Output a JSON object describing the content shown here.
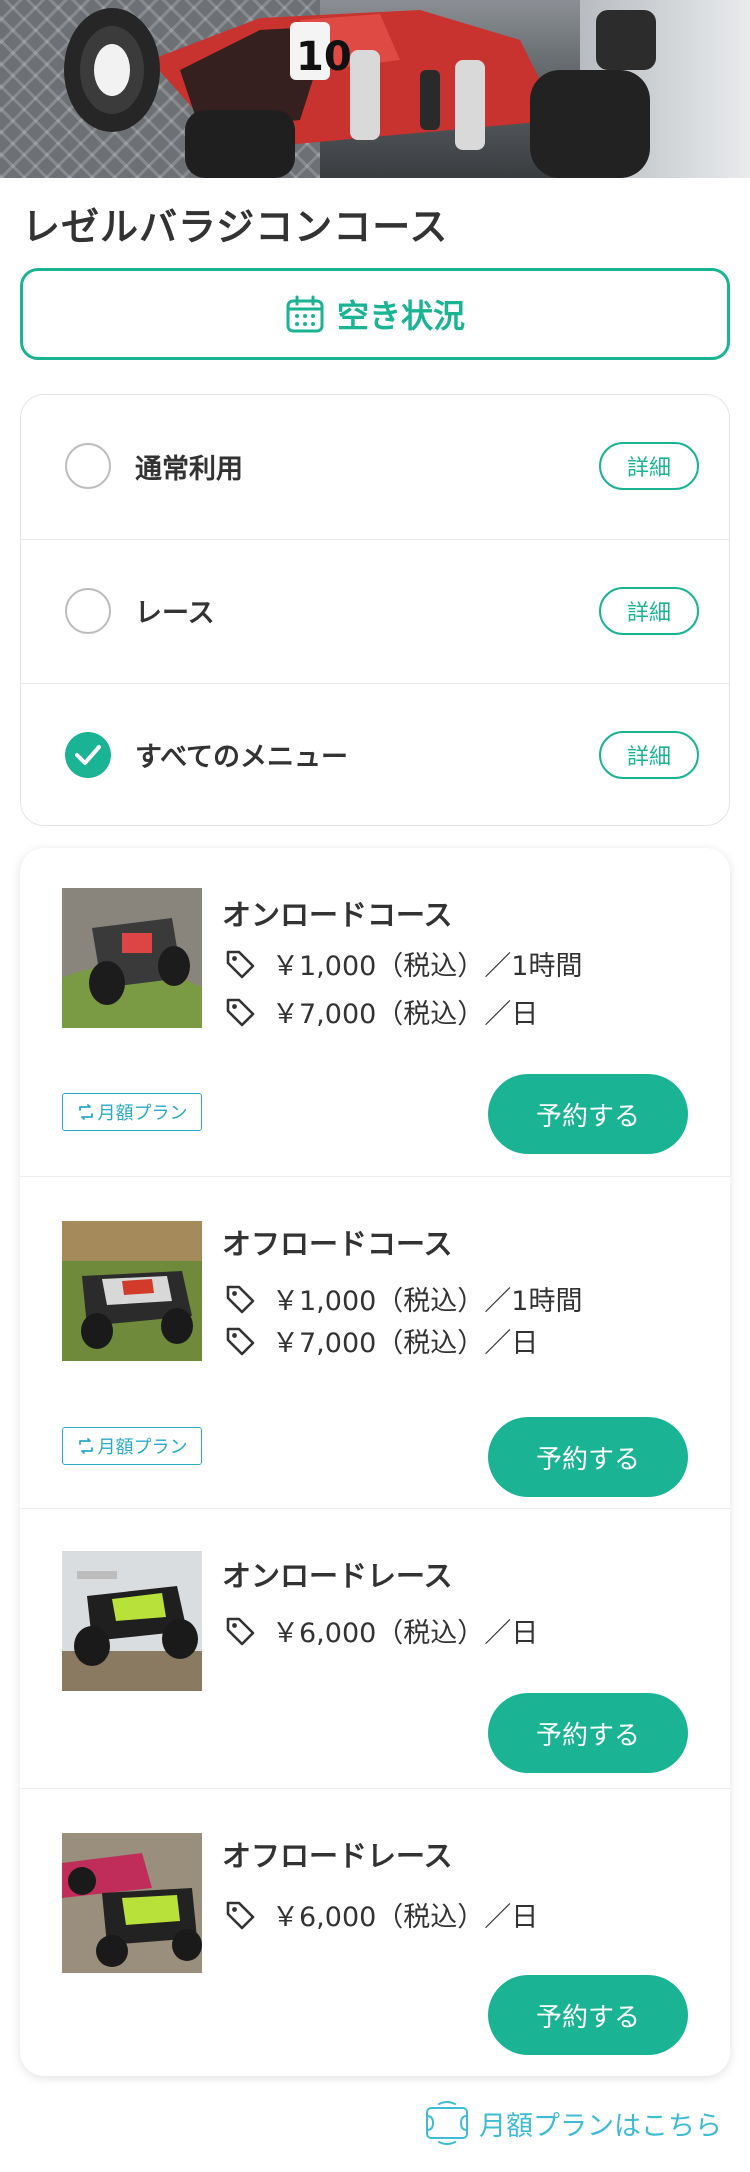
{
  "venue": {
    "title": "レゼルバラジコンコース"
  },
  "availability": {
    "label": "空き状況",
    "icon": "calendar-icon"
  },
  "filters": [
    {
      "label": "通常利用",
      "checked": false,
      "detail_label": "詳細"
    },
    {
      "label": "レース",
      "checked": false,
      "detail_label": "詳細"
    },
    {
      "label": "すべてのメニュー",
      "checked": true,
      "detail_label": "詳細"
    }
  ],
  "menu": [
    {
      "name": "オンロードコース",
      "prices": [
        "￥1,000（税込）／1時間",
        "￥7,000（税込）／日"
      ],
      "monthly_badge": "月額プラン",
      "reserve_label": "予約する"
    },
    {
      "name": "オフロードコース",
      "prices": [
        "￥1,000（税込）／1時間",
        "￥7,000（税込）／日"
      ],
      "monthly_badge": "月額プラン",
      "reserve_label": "予約する"
    },
    {
      "name": "オンロードレース",
      "prices": [
        "￥6,000（税込）／日"
      ],
      "monthly_badge": null,
      "reserve_label": "予約する"
    },
    {
      "name": "オフロードレース",
      "prices": [
        "￥6,000（税込）／日"
      ],
      "monthly_badge": null,
      "reserve_label": "予約する"
    }
  ],
  "footer": {
    "monthly_link": "月額プランはこちら"
  },
  "colors": {
    "accent": "#1ab394",
    "link": "#3fbcd3",
    "text": "#333333"
  }
}
